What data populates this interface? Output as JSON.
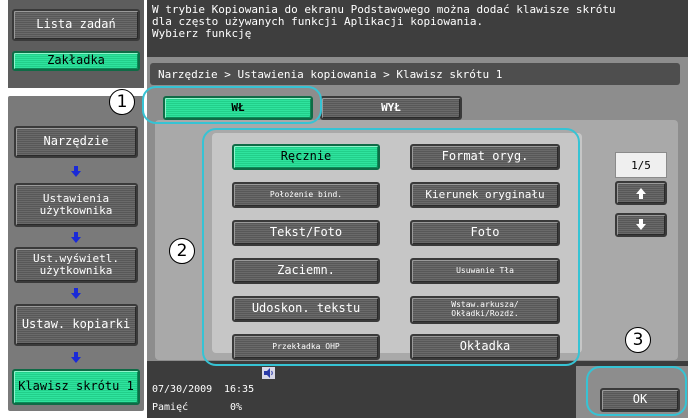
{
  "message": "W trybie Kopiowania do ekranu Podstawowego można dodać klawisze skrótu\ndla często używanych funkcji Aplikacji kopiowania.\nWybierz funkcję",
  "breadcrumb": "Narzędzie > Ustawienia kopiowania > Klawisz skrótu 1",
  "sidebar": {
    "job_list": "Lista zadań",
    "bookmark": "Zakładka",
    "items": [
      "Narzędzie",
      "Ustawienia użytkownika",
      "Ust.wyświetl. użytkownika",
      "Ustaw. kopiarki",
      "Klawisz skrótu 1"
    ]
  },
  "toggle": {
    "on": "WŁ",
    "off": "WYŁ"
  },
  "functions": {
    "left": [
      "Ręcznie",
      "Położenie bind.",
      "Tekst/Foto",
      "Zaciemn.",
      "Udoskon. tekstu",
      "Przekładka OHP"
    ],
    "right": [
      "Format oryg.",
      "Kierunek oryginału",
      "Foto",
      "Usuwanie Tła",
      "Wstaw.arkusza/ Okładki/Rozdz.",
      "Okładka"
    ]
  },
  "page_indicator": "1/5",
  "status": {
    "date": "07/30/2009",
    "time": "16:35",
    "memory_label": "Pamięć",
    "memory_value": "0%"
  },
  "ok_label": "OK",
  "callouts": [
    "1",
    "2",
    "3"
  ],
  "colors": {
    "selected": "#2fe39e",
    "callout_frame": "#36c3d4",
    "arrow": "#1a2ad8"
  }
}
